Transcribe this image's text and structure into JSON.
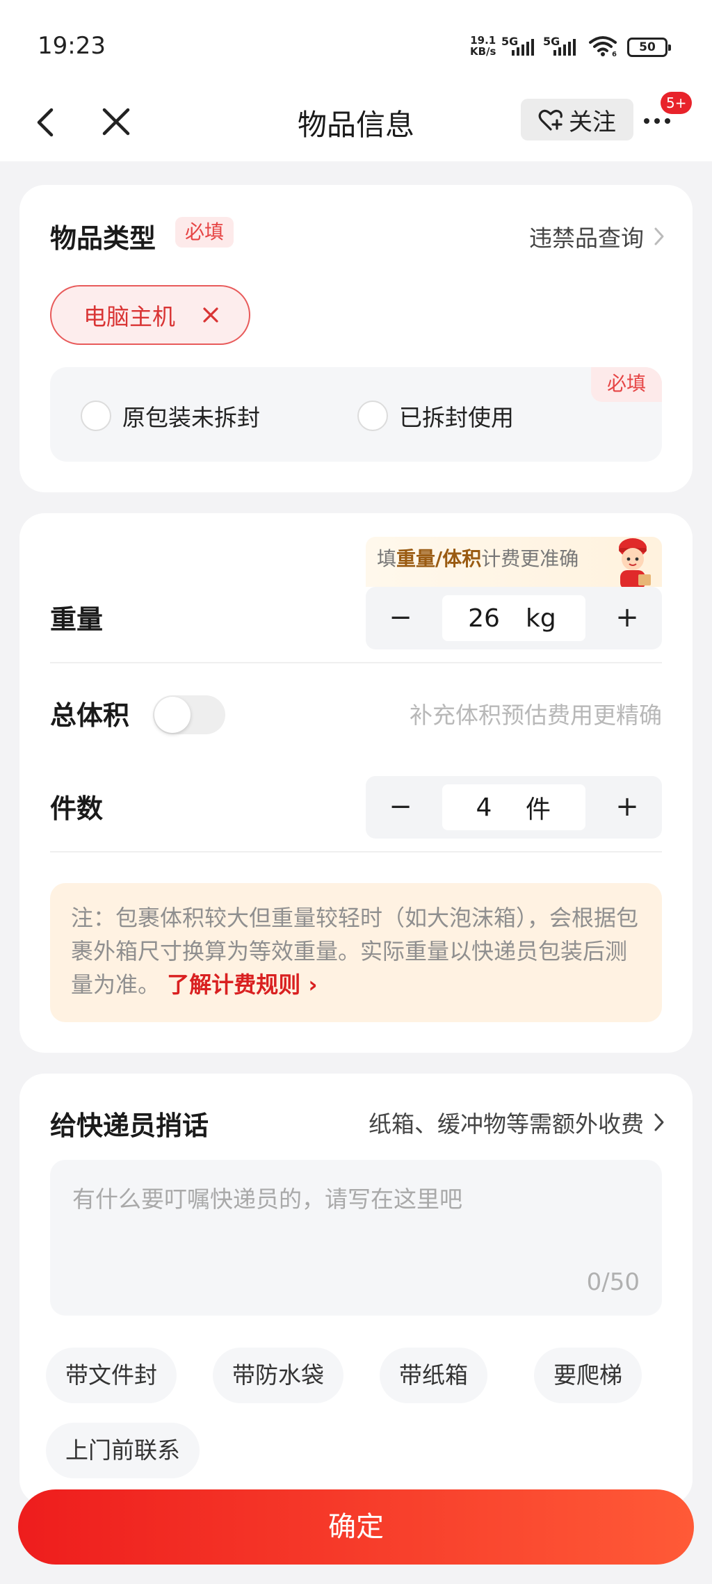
{
  "status_bar": {
    "time": "19:23",
    "net_speed_value": "19.1",
    "net_speed_unit": "KB/s",
    "signal1_label": "5G",
    "signal2_label": "5G",
    "wifi_sub": "6",
    "battery": "50"
  },
  "navbar": {
    "title": "物品信息",
    "follow_label": "关注",
    "badge": "5+"
  },
  "item_type": {
    "title": "物品类型",
    "required_tag": "必填",
    "contraband_link": "违禁品查询",
    "selected_item": "电脑主机",
    "packaging_required": "必填",
    "packaging_options": [
      "原包装未拆封",
      "已拆封使用"
    ]
  },
  "measure": {
    "tip_prefix": "填",
    "tip_bold": "重量/体积",
    "tip_suffix": "计费更准确",
    "weight_label": "重量",
    "weight_value": "26",
    "weight_unit": "kg",
    "volume_label": "总体积",
    "volume_hint": "补充体积预估费用更精确",
    "count_label": "件数",
    "count_value": "4",
    "count_unit": "件",
    "minus": "−",
    "plus": "+",
    "note_text": "注：包裹体积较大但重量较轻时（如大泡沫箱），会根据包裹外箱尺寸换算为等效重量。实际重量以快递员包装后测量为准。",
    "note_link": "了解计费规则 ›"
  },
  "message": {
    "title": "给快递员捎话",
    "extra_fee_link": "纸箱、缓冲物等需额外收费",
    "placeholder": "有什么要叮嘱快递员的，请写在这里吧",
    "counter": "0/50",
    "quick_chips": [
      "带文件封",
      "带防水袋",
      "带纸箱",
      "要爬梯",
      "上门前联系"
    ]
  },
  "confirm_label": "确定",
  "colors": {
    "primary_red": "#e8232b",
    "tag_bg": "#fdeaea",
    "note_bg": "#fff2e2"
  },
  "icons": [
    "back-arrow-icon",
    "close-icon",
    "heart-plus-icon",
    "more-dots-icon",
    "chevron-right-icon",
    "remove-x-icon",
    "courier-mascot-icon"
  ]
}
